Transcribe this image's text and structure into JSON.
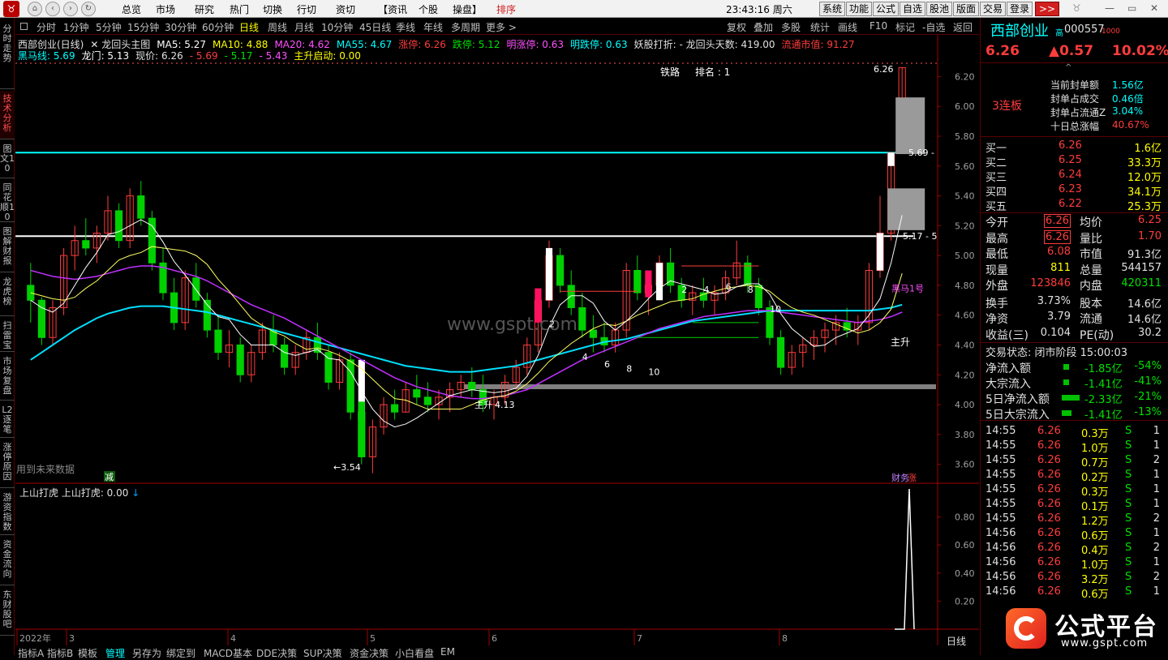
{
  "menubar": {
    "nav_icons": [
      "home-icon",
      "back-icon",
      "forward-icon",
      "refresh-icon"
    ],
    "items": [
      "总览",
      "市场",
      "研究",
      "热门",
      "切换",
      "行切",
      "资切",
      "【资讯",
      "个股",
      "操盘】"
    ],
    "highlight": "排序",
    "datetime": "23:43:16 周六",
    "right_buttons": [
      "系统",
      "功能",
      "公式",
      "自选",
      "股池",
      "版面",
      "交易",
      "登录",
      ">>"
    ],
    "win_controls": [
      "—",
      "▭",
      "✕"
    ]
  },
  "left_tabs": [
    {
      "label": "分时走势",
      "active": false
    },
    {
      "label": "技术分析",
      "active": true
    },
    {
      "label": "图文10",
      "active": false
    },
    {
      "label": "同花顺10",
      "active": false
    },
    {
      "label": "图解财报",
      "active": false
    },
    {
      "label": "龙虎榜",
      "active": false
    },
    {
      "label": "扫雷宝",
      "active": false
    },
    {
      "label": "市场复盘",
      "active": false
    },
    {
      "label": "L2逐笔",
      "active": false
    },
    {
      "label": "涨停原因",
      "active": false
    },
    {
      "label": "游资指数",
      "active": false
    },
    {
      "label": "资金流向",
      "active": false
    },
    {
      "label": "东财股吧",
      "active": false
    }
  ],
  "period_bar": {
    "periods": [
      "分时",
      "1分钟",
      "5分钟",
      "15分钟",
      "30分钟",
      "60分钟",
      "日线",
      "周线",
      "月线",
      "10分钟",
      "45日线",
      "季线",
      "年线",
      "多周期",
      "更多 >"
    ],
    "active": "日线",
    "tools": [
      "复权",
      "叠加",
      "多股",
      "统计",
      "画线",
      "F10",
      "标记",
      "-自选",
      "返回"
    ]
  },
  "indicators": {
    "line1": [
      {
        "text": "西部创业(日线)",
        "color": "#e0e0e0"
      },
      {
        "text": "✕ 龙回头主图",
        "color": "#e0e0e0"
      },
      {
        "text": "MA5: 5.27",
        "color": "#ffffff"
      },
      {
        "text": "MA10: 4.88",
        "color": "#ffff00"
      },
      {
        "text": "MA20: 4.62",
        "color": "#ff50ff"
      },
      {
        "text": "MA55: 4.67",
        "color": "#00ffff"
      },
      {
        "text": "涨停: 6.26",
        "color": "#ff3c3c"
      },
      {
        "text": "跌停: 5.12",
        "color": "#00e000"
      },
      {
        "text": "明涨停: 0.63",
        "color": "#ff50ff"
      },
      {
        "text": "明跌停: 0.63",
        "color": "#00ffff"
      },
      {
        "text": "妖股打折: - 龙回头天数: 419.00",
        "color": "#e0e0e0"
      },
      {
        "text": "流通市值: 91.27",
        "color": "#ff3c3c"
      }
    ],
    "line2": [
      {
        "text": "黑马线: 5.69",
        "color": "#00ffff"
      },
      {
        "text": "龙门: 5.13",
        "color": "#ffffff"
      },
      {
        "text": "现价: 6.26",
        "color": "#e0e0e0"
      },
      {
        "text": "- 5.69",
        "color": "#ff3c3c"
      },
      {
        "text": "- 5.17",
        "color": "#00e000"
      },
      {
        "text": "- 5.43",
        "color": "#ff50ff"
      },
      {
        "text": "主升启动: 0.00",
        "color": "#ffff00"
      }
    ],
    "sub_title": "上山打虎 上山打虎: 0.00",
    "future_note": "用到未来数据"
  },
  "annotations": {
    "tielu": "铁路",
    "rank": "排名 : 1",
    "high_label": "6.26",
    "low_label": "3.54",
    "black_horse_label": "5.69",
    "dragon_gate_label": "5.17 - 5",
    "zhusheng1": "主升",
    "zhusheng_price": "4.13",
    "zhusheng2": "主升",
    "heima_tag": "黑马1号",
    "reduce_tag": "减",
    "zt_tag": "财务",
    "zt_tag2": "涨",
    "watermark": "www.gspt.com",
    "counts": [
      "2",
      "4",
      "6",
      "8",
      "10",
      "2",
      "4",
      "6",
      "8",
      "10"
    ]
  },
  "chart_data": [
    {
      "type": "candlestick",
      "title": "西部创业(日线)",
      "y_axis_ticks": [
        3.6,
        3.8,
        4.0,
        4.2,
        4.4,
        4.6,
        4.8,
        5.0,
        5.2,
        5.4,
        5.6,
        5.8,
        6.0,
        6.2
      ],
      "ylim": [
        3.5,
        6.3
      ],
      "x_axis_labels": [
        "2022年",
        "3",
        "4",
        "5",
        "6",
        "7",
        "8"
      ],
      "horizontal_lines": [
        {
          "name": "黑马线",
          "value": 5.69,
          "color": "#00ffff"
        },
        {
          "name": "龙门",
          "value": 5.13,
          "color": "#ffffff"
        }
      ],
      "candles": [
        [
          4.8,
          4.95,
          4.55,
          4.7
        ],
        [
          4.7,
          4.72,
          4.4,
          4.45
        ],
        [
          4.45,
          4.7,
          4.4,
          4.65
        ],
        [
          4.65,
          5.05,
          4.6,
          5.0
        ],
        [
          5.0,
          5.2,
          4.9,
          5.1
        ],
        [
          5.1,
          5.25,
          5.0,
          5.05
        ],
        [
          5.05,
          5.2,
          4.95,
          5.15
        ],
        [
          5.15,
          5.4,
          5.1,
          5.3
        ],
        [
          5.3,
          5.35,
          5.05,
          5.1
        ],
        [
          5.1,
          5.45,
          5.05,
          5.4
        ],
        [
          5.4,
          5.5,
          5.2,
          5.25
        ],
        [
          5.25,
          5.3,
          4.9,
          4.95
        ],
        [
          4.95,
          5.05,
          4.7,
          4.75
        ],
        [
          4.75,
          4.85,
          4.5,
          4.55
        ],
        [
          4.55,
          4.9,
          4.5,
          4.85
        ],
        [
          4.85,
          4.95,
          4.65,
          4.7
        ],
        [
          4.7,
          4.75,
          4.45,
          4.5
        ],
        [
          4.5,
          4.6,
          4.3,
          4.35
        ],
        [
          4.35,
          4.5,
          4.25,
          4.4
        ],
        [
          4.4,
          4.45,
          4.15,
          4.2
        ],
        [
          4.2,
          4.4,
          4.15,
          4.35
        ],
        [
          4.35,
          4.55,
          4.3,
          4.5
        ],
        [
          4.5,
          4.6,
          4.35,
          4.4
        ],
        [
          4.4,
          4.45,
          4.2,
          4.25
        ],
        [
          4.25,
          4.4,
          4.2,
          4.35
        ],
        [
          4.35,
          4.5,
          4.3,
          4.45
        ],
        [
          4.45,
          4.55,
          4.3,
          4.35
        ],
        [
          4.35,
          4.4,
          4.1,
          4.15
        ],
        [
          4.15,
          4.35,
          4.1,
          4.3
        ],
        [
          4.3,
          4.35,
          3.9,
          3.95
        ],
        [
          3.95,
          4.0,
          3.6,
          3.65
        ],
        [
          3.65,
          3.9,
          3.54,
          3.85
        ],
        [
          3.85,
          4.05,
          3.8,
          4.0
        ],
        [
          4.0,
          4.1,
          3.9,
          3.95
        ],
        [
          3.95,
          4.15,
          3.95,
          4.1
        ],
        [
          4.1,
          4.2,
          4.0,
          4.05
        ],
        [
          4.05,
          4.15,
          3.95,
          4.0
        ],
        [
          4.0,
          4.1,
          3.9,
          4.05
        ],
        [
          4.05,
          4.15,
          3.95,
          4.1
        ],
        [
          4.1,
          4.2,
          4.05,
          4.15
        ],
        [
          4.15,
          4.25,
          4.05,
          4.1
        ],
        [
          4.1,
          4.2,
          3.95,
          4.0
        ],
        [
          4.0,
          4.1,
          3.9,
          4.05
        ],
        [
          4.05,
          4.2,
          4.0,
          4.15
        ],
        [
          4.15,
          4.3,
          4.1,
          4.25
        ],
        [
          4.25,
          4.45,
          4.2,
          4.4
        ],
        [
          4.4,
          4.75,
          4.35,
          4.7
        ],
        [
          4.7,
          5.1,
          4.65,
          5.0
        ],
        [
          5.0,
          5.05,
          4.75,
          4.8
        ],
        [
          4.8,
          4.9,
          4.6,
          4.65
        ],
        [
          4.65,
          4.75,
          4.45,
          4.5
        ],
        [
          4.5,
          4.6,
          4.35,
          4.45
        ],
        [
          4.45,
          4.55,
          4.35,
          4.4
        ],
        [
          4.4,
          4.55,
          4.35,
          4.5
        ],
        [
          4.5,
          4.95,
          4.45,
          4.9
        ],
        [
          4.9,
          5.0,
          4.7,
          4.75
        ],
        [
          4.75,
          4.85,
          4.6,
          4.8
        ],
        [
          4.8,
          5.0,
          4.7,
          4.95
        ],
        [
          4.95,
          5.05,
          4.75,
          4.8
        ],
        [
          4.8,
          4.85,
          4.65,
          4.7
        ],
        [
          4.7,
          4.8,
          4.6,
          4.75
        ],
        [
          4.75,
          4.85,
          4.65,
          4.7
        ],
        [
          4.7,
          4.8,
          4.6,
          4.75
        ],
        [
          4.75,
          4.9,
          4.7,
          4.85
        ],
        [
          4.85,
          5.1,
          4.8,
          4.95
        ],
        [
          4.95,
          5.0,
          4.75,
          4.8
        ],
        [
          4.8,
          4.85,
          4.6,
          4.65
        ],
        [
          4.65,
          4.7,
          4.4,
          4.45
        ],
        [
          4.45,
          4.5,
          4.2,
          4.25
        ],
        [
          4.25,
          4.4,
          4.2,
          4.35
        ],
        [
          4.35,
          4.45,
          4.25,
          4.4
        ],
        [
          4.4,
          4.5,
          4.3,
          4.45
        ],
        [
          4.45,
          4.55,
          4.35,
          4.5
        ],
        [
          4.5,
          4.6,
          4.4,
          4.55
        ],
        [
          4.55,
          4.65,
          4.45,
          4.5
        ],
        [
          4.5,
          4.6,
          4.4,
          4.55
        ],
        [
          4.55,
          4.95,
          4.5,
          4.9
        ],
        [
          4.9,
          5.4,
          4.85,
          5.15
        ],
        [
          5.15,
          5.69,
          5.1,
          5.69
        ],
        [
          5.69,
          6.26,
          5.69,
          6.26
        ]
      ],
      "ma5": [
        4.7,
        4.65,
        4.62,
        4.68,
        4.8,
        4.92,
        5.02,
        5.14,
        5.16,
        5.2,
        5.24,
        5.2,
        5.09,
        4.96,
        4.87,
        4.77,
        4.67,
        4.59,
        4.57,
        4.47,
        4.4,
        4.4,
        4.4,
        4.35,
        4.33,
        4.35,
        4.37,
        4.31,
        4.3,
        4.22,
        4.09,
        3.97,
        3.89,
        3.85,
        3.87,
        3.91,
        3.96,
        4.01,
        4.06,
        4.08,
        4.1,
        4.09,
        4.08,
        4.09,
        4.11,
        4.19,
        4.33,
        4.52,
        4.67,
        4.73,
        4.73,
        4.68,
        4.56,
        4.5,
        4.56,
        4.63,
        4.71,
        4.78,
        4.83,
        4.81,
        4.79,
        4.77,
        4.74,
        4.75,
        4.79,
        4.81,
        4.81,
        4.74,
        4.61,
        4.51,
        4.45,
        4.39,
        4.4,
        4.45,
        4.48,
        4.51,
        4.6,
        4.71,
        4.95,
        5.27
      ],
      "ma10": [
        4.75,
        4.73,
        4.71,
        4.7,
        4.72,
        4.78,
        4.83,
        4.9,
        4.97,
        5.0,
        5.02,
        5.06,
        5.05,
        5.04,
        5.03,
        5.0,
        4.94,
        4.84,
        4.76,
        4.67,
        4.58,
        4.53,
        4.49,
        4.46,
        4.41,
        4.37,
        4.38,
        4.36,
        4.33,
        4.29,
        4.24,
        4.17,
        4.1,
        4.04,
        4.03,
        4.0,
        3.97,
        3.97,
        3.97,
        3.97,
        4.0,
        4.03,
        4.05,
        4.06,
        4.09,
        4.14,
        4.21,
        4.29,
        4.35,
        4.41,
        4.46,
        4.51,
        4.54,
        4.53,
        4.56,
        4.6,
        4.63,
        4.66,
        4.69,
        4.7,
        4.71,
        4.74,
        4.76,
        4.78,
        4.79,
        4.8,
        4.79,
        4.76,
        4.7,
        4.65,
        4.62,
        4.6,
        4.57,
        4.54,
        4.51,
        4.48,
        4.5,
        4.55,
        4.64,
        4.88
      ],
      "ma20": [
        4.9,
        4.88,
        4.86,
        4.85,
        4.84,
        4.85,
        4.86,
        4.88,
        4.9,
        4.92,
        4.93,
        4.93,
        4.92,
        4.9,
        4.88,
        4.86,
        4.83,
        4.79,
        4.75,
        4.71,
        4.67,
        4.64,
        4.61,
        4.58,
        4.54,
        4.5,
        4.46,
        4.42,
        4.38,
        4.34,
        4.3,
        4.26,
        4.22,
        4.18,
        4.15,
        4.12,
        4.1,
        4.08,
        4.06,
        4.05,
        4.04,
        4.04,
        4.05,
        4.06,
        4.08,
        4.1,
        4.14,
        4.18,
        4.22,
        4.26,
        4.3,
        4.33,
        4.36,
        4.39,
        4.42,
        4.45,
        4.48,
        4.51,
        4.53,
        4.55,
        4.57,
        4.59,
        4.6,
        4.61,
        4.62,
        4.63,
        4.63,
        4.63,
        4.62,
        4.61,
        4.6,
        4.59,
        4.58,
        4.57,
        4.56,
        4.55,
        4.56,
        4.57,
        4.59,
        4.62
      ],
      "ma55": [
        4.3,
        4.35,
        4.4,
        4.45,
        4.5,
        4.54,
        4.58,
        4.61,
        4.63,
        4.65,
        4.66,
        4.66,
        4.66,
        4.65,
        4.64,
        4.63,
        4.62,
        4.6,
        4.58,
        4.56,
        4.54,
        4.52,
        4.5,
        4.48,
        4.46,
        4.44,
        4.42,
        4.4,
        4.38,
        4.36,
        4.34,
        4.32,
        4.3,
        4.28,
        4.26,
        4.25,
        4.24,
        4.23,
        4.22,
        4.22,
        4.22,
        4.23,
        4.24,
        4.25,
        4.26,
        4.28,
        4.3,
        4.32,
        4.34,
        4.36,
        4.38,
        4.4,
        4.42,
        4.43,
        4.44,
        4.46,
        4.48,
        4.5,
        4.52,
        4.54,
        4.56,
        4.57,
        4.58,
        4.59,
        4.6,
        4.61,
        4.62,
        4.63,
        4.63,
        4.63,
        4.63,
        4.63,
        4.63,
        4.63,
        4.63,
        4.63,
        4.63,
        4.64,
        4.65,
        4.67
      ]
    },
    {
      "type": "line",
      "title": "上山打虎",
      "y_axis_ticks": [
        0.2,
        0.4,
        0.6,
        0.8
      ],
      "ylim": [
        0,
        1.0
      ],
      "values_last": [
        0,
        0,
        0,
        1,
        0
      ]
    }
  ],
  "right_panel": {
    "stock_name": "西部创业",
    "stock_tag": "高",
    "stock_code": "000557",
    "code_suffix": "1000",
    "price": "6.26",
    "change": "▲0.57",
    "change_pct": "10.02%",
    "limit_days": "3连板",
    "seal_info": [
      {
        "label": "当前封单额",
        "value": "1.56亿"
      },
      {
        "label": "封单占成交",
        "value": "0.46倍"
      },
      {
        "label": "封单占流通Z",
        "value": "3.04%"
      },
      {
        "label": "十日总涨幅",
        "value": "40.67%"
      }
    ],
    "bids": [
      {
        "label": "买一",
        "price": "6.26",
        "vol": "1.6亿"
      },
      {
        "label": "买二",
        "price": "6.25",
        "vol": "33.3万"
      },
      {
        "label": "买三",
        "price": "6.24",
        "vol": "12.0万"
      },
      {
        "label": "买四",
        "price": "6.23",
        "vol": "34.1万"
      },
      {
        "label": "买五",
        "price": "6.22",
        "vol": "25.3万"
      }
    ],
    "stats": [
      {
        "l1": "今开",
        "v1": "6.26",
        "l2": "均价",
        "v2": "6.25"
      },
      {
        "l1": "最高",
        "v1": "6.26",
        "l2": "量比",
        "v2": "1.70"
      },
      {
        "l1": "最低",
        "v1": "6.08",
        "l2": "市值",
        "v2": "91.3亿"
      },
      {
        "l1": "现量",
        "v1": "811",
        "l2": "总量",
        "v2": "544157"
      },
      {
        "l1": "外盘",
        "v1": "123846",
        "l2": "内盘",
        "v2": "420311"
      },
      {
        "l1": "换手",
        "v1": "3.73%",
        "l2": "股本",
        "v2": "14.6亿"
      },
      {
        "l1": "净资",
        "v1": "3.79",
        "l2": "流通",
        "v2": "14.6亿"
      },
      {
        "l1": "收益(三)",
        "v1": "0.104",
        "l2": "PE(动)",
        "v2": "30.2"
      }
    ],
    "trade_status": "交易状态: 闭市阶段 15:00:03",
    "flows": [
      {
        "label": "净流入额",
        "value": "-1.85亿",
        "pct": "-54%",
        "bar": 0.2
      },
      {
        "label": "大宗流入",
        "value": "-1.41亿",
        "pct": "-41%",
        "bar": 0.2
      },
      {
        "label": "5日净流入额",
        "value": "-2.33亿",
        "pct": "-21%",
        "bar": 0.65
      },
      {
        "label": "5日大宗流入",
        "value": "-1.41亿",
        "pct": "-13%",
        "bar": 0.35
      }
    ],
    "ticks": [
      [
        "14:55",
        "6.26",
        "0.3万",
        "S",
        "1"
      ],
      [
        "14:55",
        "6.26",
        "1.0万",
        "S",
        "1"
      ],
      [
        "14:55",
        "6.26",
        "0.7万",
        "S",
        "2"
      ],
      [
        "14:55",
        "6.26",
        "0.2万",
        "S",
        "1"
      ],
      [
        "14:55",
        "6.26",
        "0.3万",
        "S",
        "1"
      ],
      [
        "14:55",
        "6.26",
        "0.1万",
        "S",
        "1"
      ],
      [
        "14:55",
        "6.26",
        "1.2万",
        "S",
        "2"
      ],
      [
        "14:56",
        "6.26",
        "0.6万",
        "S",
        "1"
      ],
      [
        "14:56",
        "6.26",
        "0.4万",
        "S",
        "2"
      ],
      [
        "14:56",
        "6.26",
        "1.0万",
        "S",
        "1"
      ],
      [
        "14:56",
        "6.26",
        "3.2万",
        "S",
        "2"
      ],
      [
        "14:56",
        "6.26",
        "0.6万",
        "S",
        "1"
      ]
    ],
    "bottom_label": "日线"
  },
  "bottom_tabs": [
    "指标A",
    "指标B",
    "模板",
    "管理",
    "另存为",
    "绑定到",
    "MACD基本",
    "DDE决策",
    "SUP决策",
    "资金决策",
    "小白看盘",
    "EM"
  ],
  "logo_text": "公式平台",
  "logo_url": "www.gspt.com"
}
